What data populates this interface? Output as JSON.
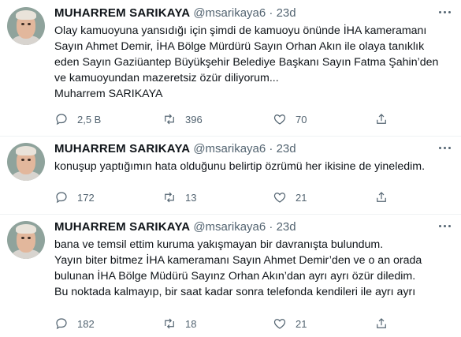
{
  "tweets": [
    {
      "name": "MUHARREM SARIKAYA",
      "handle": "@msarikaya6",
      "separator": "·",
      "time": "23d",
      "lines": [
        "Olay kamuoyuna yansıdığı için şimdi de kamuoyu önünde İHA kameramanı",
        "Sayın Ahmet Demir, İHA Bölge Mürdürü Sayın Orhan Akın ile olaya tanıklık",
        "eden Sayın Gaziüantep Büyükşehir Belediye Başkanı Sayın Fatma Şahin’den",
        "ve kamuoyundan  mazeretsiz özür diliyorum...",
        "Muharrem SARIKAYA"
      ],
      "replies": "2,5 B",
      "retweets": "396",
      "likes": "70",
      "share": ""
    },
    {
      "name": "MUHARREM SARIKAYA",
      "handle": "@msarikaya6",
      "separator": "·",
      "time": "23d",
      "lines": [
        "konuşup yaptığımın hata olduğunu belirtip özrümü her ikisine de yineledim."
      ],
      "replies": "172",
      "retweets": "13",
      "likes": "21",
      "share": ""
    },
    {
      "name": "MUHARREM SARIKAYA",
      "handle": "@msarikaya6",
      "separator": "·",
      "time": "23d",
      "lines": [
        "bana ve temsil ettim kuruma yakışmayan bir davranışta bulundum.",
        "Yayın biter bitmez İHA kameramanı Sayın Ahmet Demir’den ve o an orada",
        "bulunan İHA Bölge Müdürü Sayınz Orhan Akın’dan ayrı ayrı özür diledim.",
        "Bu noktada kalmayıp, bir saat kadar sonra telefonda kendileri ile ayrı ayrı"
      ],
      "replies": "182",
      "retweets": "18",
      "likes": "21",
      "share": ""
    }
  ],
  "icons": {
    "reply": "reply-icon",
    "retweet": "retweet-icon",
    "like": "like-icon",
    "share": "share-icon",
    "more": "more-icon"
  },
  "colors": {
    "text": "#0f1419",
    "secondary": "#536471",
    "divider": "#eff3f4"
  }
}
